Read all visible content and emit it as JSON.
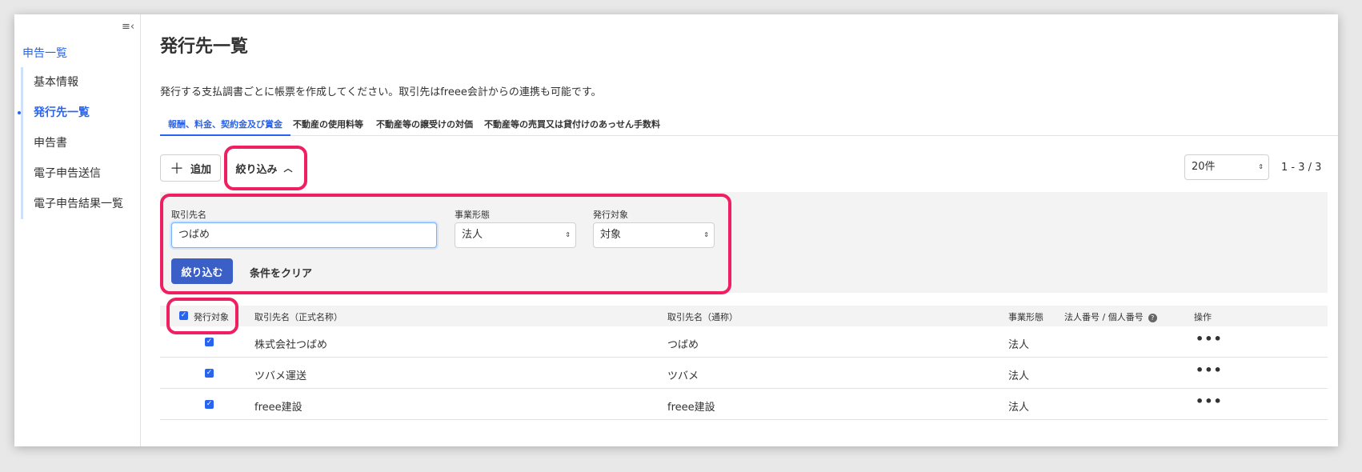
{
  "sidebar": {
    "collapse_icon": "≡‹",
    "root": "申告一覧",
    "items": [
      {
        "label": "基本情報"
      },
      {
        "label": "発行先一覧"
      },
      {
        "label": "申告書"
      },
      {
        "label": "電子申告送信"
      },
      {
        "label": "電子申告結果一覧"
      }
    ]
  },
  "page": {
    "title": "発行先一覧",
    "description": "発行する支払調書ごとに帳票を作成してください。取引先はfreee会計からの連携も可能です。"
  },
  "tabs": [
    {
      "label": "報酬、料金、契約金及び賞金"
    },
    {
      "label": "不動産の使用料等"
    },
    {
      "label": "不動産等の譲受けの対価"
    },
    {
      "label": "不動産等の売買又は貸付けのあっせん手数料"
    }
  ],
  "toolbar": {
    "add_label": "追加",
    "filter_label": "絞り込み",
    "per_page": "20件",
    "page_range": "1 - 3 / 3"
  },
  "filter": {
    "name_label": "取引先名",
    "name_value": "つばめ",
    "type_label": "事業形態",
    "type_value": "法人",
    "target_label": "発行対象",
    "target_value": "対象",
    "apply_label": "絞り込む",
    "clear_label": "条件をクリア"
  },
  "table": {
    "headers": {
      "target": "発行対象",
      "formal_name": "取引先名（正式名称）",
      "common_name": "取引先名（通称）",
      "type": "事業形態",
      "number": "法人番号 / 個人番号",
      "actions": "操作"
    },
    "rows": [
      {
        "formal_name": "株式会社つばめ",
        "common_name": "つばめ",
        "type": "法人"
      },
      {
        "formal_name": "ツバメ運送",
        "common_name": "ツバメ",
        "type": "法人"
      },
      {
        "formal_name": "freee建設",
        "common_name": "freee建設",
        "type": "法人"
      }
    ]
  },
  "colors": {
    "accent": "#2864f0",
    "primary_button": "#3a5fc6",
    "highlight": "#ef1f62"
  }
}
